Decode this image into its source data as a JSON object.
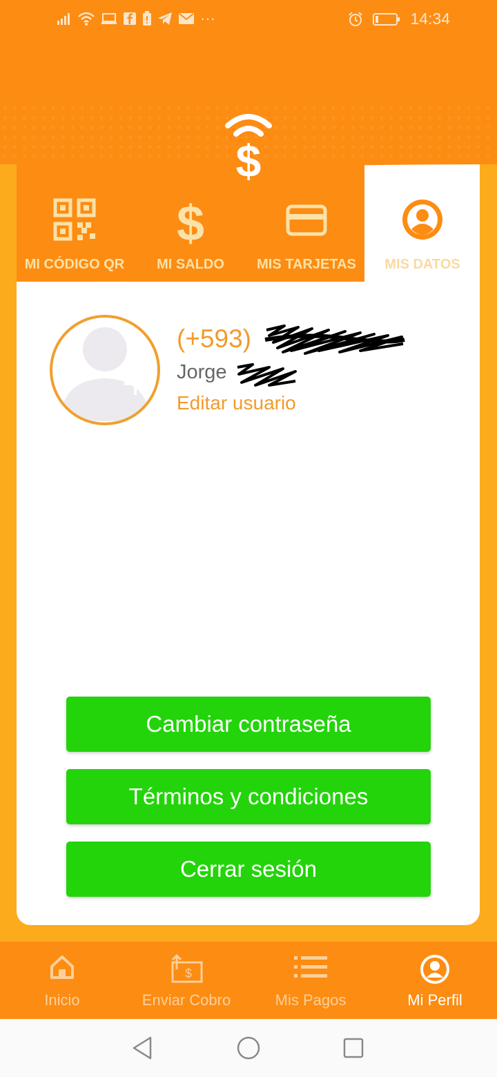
{
  "status_bar": {
    "time": "14:34",
    "icons": [
      "signal-icon",
      "wifi-icon",
      "laptop-icon",
      "facebook-icon",
      "battery-saver-icon",
      "telegram-icon",
      "mail-icon",
      "more-icon",
      "alarm-icon",
      "battery-icon"
    ],
    "more": "···"
  },
  "tabs": [
    {
      "label": "MI CÓDIGO QR",
      "icon": "qr-code-icon",
      "active": false
    },
    {
      "label": "MI SALDO",
      "icon": "dollar-icon",
      "active": false
    },
    {
      "label": "MIS TARJETAS",
      "icon": "card-icon",
      "active": false
    },
    {
      "label": "MIS DATOS",
      "icon": "user-circle-icon",
      "active": true
    }
  ],
  "profile": {
    "phone_prefix": "(+593)",
    "first_name": "Jorge",
    "edit_label": "Editar usuario"
  },
  "actions": {
    "change_password": "Cambiar contraseña",
    "terms": "Términos y condiciones",
    "logout": "Cerrar sesión"
  },
  "bottom_nav": [
    {
      "label": "Inicio",
      "icon": "home-icon",
      "active": false
    },
    {
      "label": "Enviar Cobro",
      "icon": "send-payment-icon",
      "active": false
    },
    {
      "label": "Mis Pagos",
      "icon": "list-icon",
      "active": false
    },
    {
      "label": "Mi Perfil",
      "icon": "user-circle-icon",
      "active": true
    }
  ],
  "colors": {
    "header_orange": "#fd8c13",
    "page_yellow": "#fbab1c",
    "accent": "#f29a2c",
    "button_green": "#23d40a"
  }
}
